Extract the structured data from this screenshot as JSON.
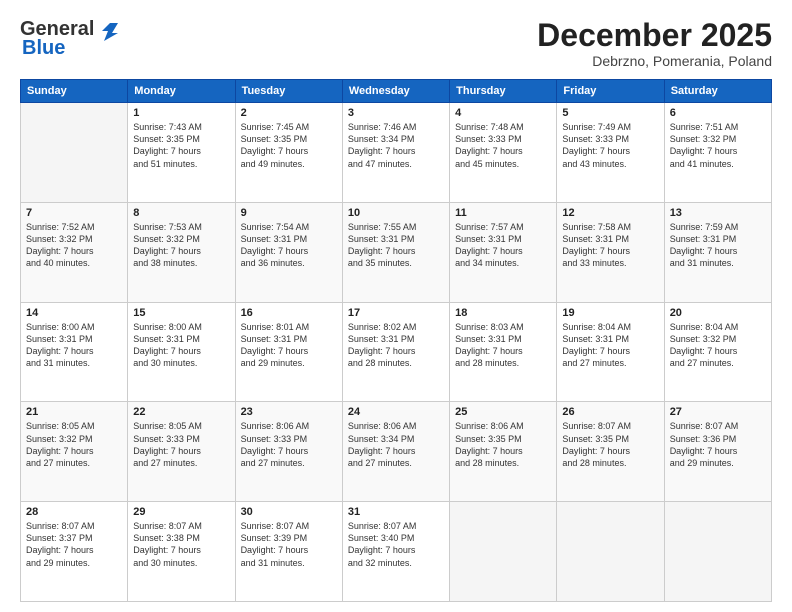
{
  "header": {
    "logo_general": "General",
    "logo_blue": "Blue",
    "month_title": "December 2025",
    "location": "Debrzno, Pomerania, Poland"
  },
  "days_of_week": [
    "Sunday",
    "Monday",
    "Tuesday",
    "Wednesday",
    "Thursday",
    "Friday",
    "Saturday"
  ],
  "weeks": [
    [
      {
        "day": "",
        "info": ""
      },
      {
        "day": "1",
        "info": "Sunrise: 7:43 AM\nSunset: 3:35 PM\nDaylight: 7 hours\nand 51 minutes."
      },
      {
        "day": "2",
        "info": "Sunrise: 7:45 AM\nSunset: 3:35 PM\nDaylight: 7 hours\nand 49 minutes."
      },
      {
        "day": "3",
        "info": "Sunrise: 7:46 AM\nSunset: 3:34 PM\nDaylight: 7 hours\nand 47 minutes."
      },
      {
        "day": "4",
        "info": "Sunrise: 7:48 AM\nSunset: 3:33 PM\nDaylight: 7 hours\nand 45 minutes."
      },
      {
        "day": "5",
        "info": "Sunrise: 7:49 AM\nSunset: 3:33 PM\nDaylight: 7 hours\nand 43 minutes."
      },
      {
        "day": "6",
        "info": "Sunrise: 7:51 AM\nSunset: 3:32 PM\nDaylight: 7 hours\nand 41 minutes."
      }
    ],
    [
      {
        "day": "7",
        "info": "Sunrise: 7:52 AM\nSunset: 3:32 PM\nDaylight: 7 hours\nand 40 minutes."
      },
      {
        "day": "8",
        "info": "Sunrise: 7:53 AM\nSunset: 3:32 PM\nDaylight: 7 hours\nand 38 minutes."
      },
      {
        "day": "9",
        "info": "Sunrise: 7:54 AM\nSunset: 3:31 PM\nDaylight: 7 hours\nand 36 minutes."
      },
      {
        "day": "10",
        "info": "Sunrise: 7:55 AM\nSunset: 3:31 PM\nDaylight: 7 hours\nand 35 minutes."
      },
      {
        "day": "11",
        "info": "Sunrise: 7:57 AM\nSunset: 3:31 PM\nDaylight: 7 hours\nand 34 minutes."
      },
      {
        "day": "12",
        "info": "Sunrise: 7:58 AM\nSunset: 3:31 PM\nDaylight: 7 hours\nand 33 minutes."
      },
      {
        "day": "13",
        "info": "Sunrise: 7:59 AM\nSunset: 3:31 PM\nDaylight: 7 hours\nand 31 minutes."
      }
    ],
    [
      {
        "day": "14",
        "info": "Sunrise: 8:00 AM\nSunset: 3:31 PM\nDaylight: 7 hours\nand 31 minutes."
      },
      {
        "day": "15",
        "info": "Sunrise: 8:00 AM\nSunset: 3:31 PM\nDaylight: 7 hours\nand 30 minutes."
      },
      {
        "day": "16",
        "info": "Sunrise: 8:01 AM\nSunset: 3:31 PM\nDaylight: 7 hours\nand 29 minutes."
      },
      {
        "day": "17",
        "info": "Sunrise: 8:02 AM\nSunset: 3:31 PM\nDaylight: 7 hours\nand 28 minutes."
      },
      {
        "day": "18",
        "info": "Sunrise: 8:03 AM\nSunset: 3:31 PM\nDaylight: 7 hours\nand 28 minutes."
      },
      {
        "day": "19",
        "info": "Sunrise: 8:04 AM\nSunset: 3:31 PM\nDaylight: 7 hours\nand 27 minutes."
      },
      {
        "day": "20",
        "info": "Sunrise: 8:04 AM\nSunset: 3:32 PM\nDaylight: 7 hours\nand 27 minutes."
      }
    ],
    [
      {
        "day": "21",
        "info": "Sunrise: 8:05 AM\nSunset: 3:32 PM\nDaylight: 7 hours\nand 27 minutes."
      },
      {
        "day": "22",
        "info": "Sunrise: 8:05 AM\nSunset: 3:33 PM\nDaylight: 7 hours\nand 27 minutes."
      },
      {
        "day": "23",
        "info": "Sunrise: 8:06 AM\nSunset: 3:33 PM\nDaylight: 7 hours\nand 27 minutes."
      },
      {
        "day": "24",
        "info": "Sunrise: 8:06 AM\nSunset: 3:34 PM\nDaylight: 7 hours\nand 27 minutes."
      },
      {
        "day": "25",
        "info": "Sunrise: 8:06 AM\nSunset: 3:35 PM\nDaylight: 7 hours\nand 28 minutes."
      },
      {
        "day": "26",
        "info": "Sunrise: 8:07 AM\nSunset: 3:35 PM\nDaylight: 7 hours\nand 28 minutes."
      },
      {
        "day": "27",
        "info": "Sunrise: 8:07 AM\nSunset: 3:36 PM\nDaylight: 7 hours\nand 29 minutes."
      }
    ],
    [
      {
        "day": "28",
        "info": "Sunrise: 8:07 AM\nSunset: 3:37 PM\nDaylight: 7 hours\nand 29 minutes."
      },
      {
        "day": "29",
        "info": "Sunrise: 8:07 AM\nSunset: 3:38 PM\nDaylight: 7 hours\nand 30 minutes."
      },
      {
        "day": "30",
        "info": "Sunrise: 8:07 AM\nSunset: 3:39 PM\nDaylight: 7 hours\nand 31 minutes."
      },
      {
        "day": "31",
        "info": "Sunrise: 8:07 AM\nSunset: 3:40 PM\nDaylight: 7 hours\nand 32 minutes."
      },
      {
        "day": "",
        "info": ""
      },
      {
        "day": "",
        "info": ""
      },
      {
        "day": "",
        "info": ""
      }
    ]
  ]
}
